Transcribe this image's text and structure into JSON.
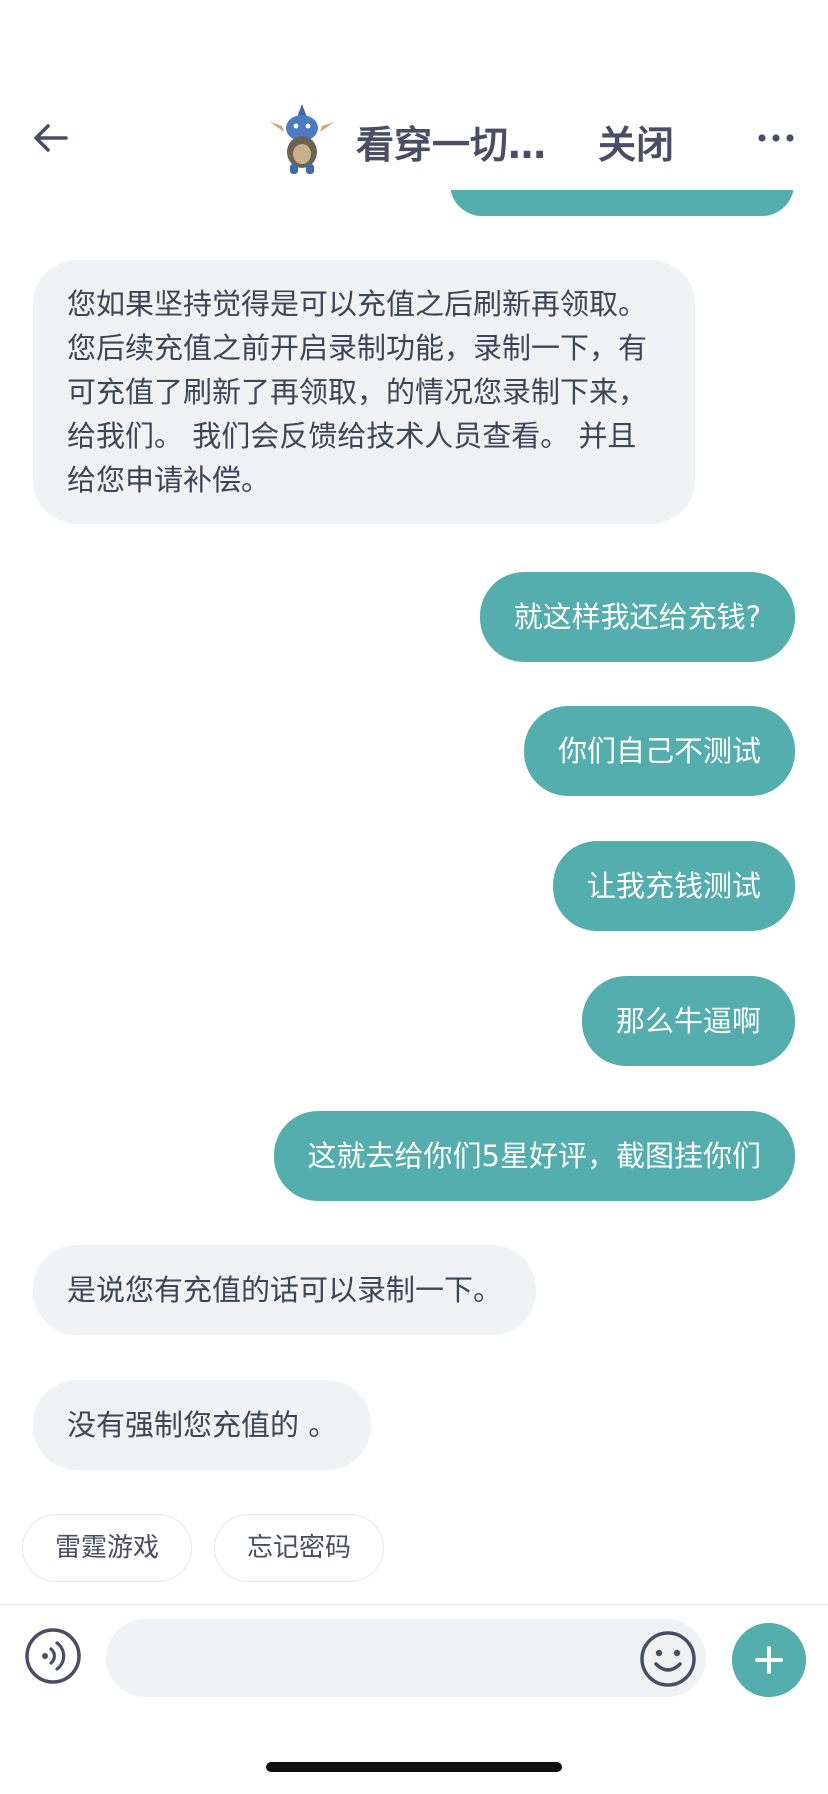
{
  "header": {
    "title": "看穿一切…",
    "close_label": "关闭"
  },
  "messages": [
    {
      "side": "in",
      "text": "您如果坚持觉得是可以充值之后刷新再领取。 您后续充值之前开启录制功能，录制一下，有可充值了刷新了再领取，的情况您录制下来，给我们。 我们会反馈给技术人员查看。 并且给您申请补偿。"
    },
    {
      "side": "out",
      "text": "就这样我还给充钱?"
    },
    {
      "side": "out",
      "text": "你们自己不测试"
    },
    {
      "side": "out",
      "text": "让我充钱测试"
    },
    {
      "side": "out",
      "text": "那么牛逼啊"
    },
    {
      "side": "out",
      "text": "这就去给你们5星好评，截图挂你们"
    },
    {
      "side": "in",
      "text": "是说您有充值的话可以录制一下。"
    },
    {
      "side": "in",
      "text": "没有强制您充值的 。"
    }
  ],
  "quick_replies": [
    "雷霆游戏",
    "忘记密码"
  ],
  "input": {
    "placeholder": ""
  },
  "colors": {
    "outgoing_bubble": "#54aeae",
    "incoming_bubble": "#f1f2f4",
    "text_dark": "#3f4457"
  }
}
